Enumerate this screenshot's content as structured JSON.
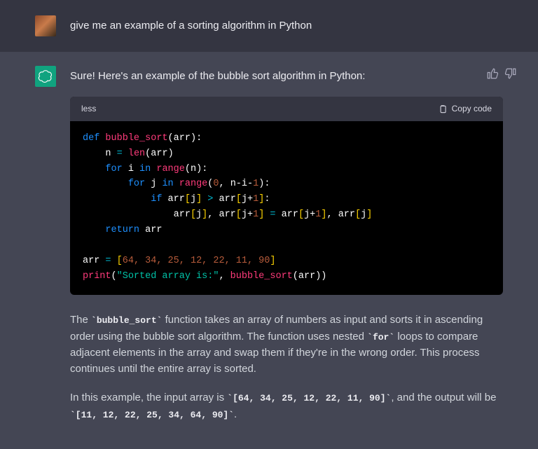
{
  "user": {
    "text": "give me an example of a sorting algorithm in Python"
  },
  "assistant": {
    "intro": "Sure! Here's an example of the bubble sort algorithm in Python:",
    "code": {
      "lang": "less",
      "copy_label": "Copy code",
      "l1_def": "def",
      "l1_fn": "bubble_sort",
      "l1_arr": "arr",
      "l2_n": "n",
      "l2_len": "len",
      "l2_arr": "arr",
      "l3_for": "for",
      "l3_i": "i",
      "l3_in": "in",
      "l3_range": "range",
      "l3_n": "n",
      "l4_for": "for",
      "l4_j": "j",
      "l4_in": "in",
      "l4_range": "range",
      "l4_z": "0",
      "l4_expr1": "n-i-",
      "l4_one": "1",
      "l5_if": "if",
      "l5_arr1": "arr",
      "l5_j1": "j",
      "l5_arr2": "arr",
      "l5_j2": "j+",
      "l5_one": "1",
      "l6_arr1": "arr",
      "l6_j1": "j",
      "l6_arr2": "arr",
      "l6_j2": "j+",
      "l6_one1": "1",
      "l6_arr3": "arr",
      "l6_j3": "j+",
      "l6_one2": "1",
      "l6_arr4": "arr",
      "l6_j4": "j",
      "l7_return": "return",
      "l7_arr": "arr",
      "l9_arr": "arr",
      "l9_list": "64, 34, 25, 12, 22, 11, 90",
      "l10_print": "print",
      "l10_str": "\"Sorted array is:\"",
      "l10_fn": "bubble_sort",
      "l10_arr": "arr"
    },
    "para1_a": "The ",
    "para1_code1": "`bubble_sort`",
    "para1_b": " function takes an array of numbers as input and sorts it in ascending order using the bubble sort algorithm. The function uses nested ",
    "para1_code2": "`for`",
    "para1_c": " loops to compare adjacent elements in the array and swap them if they're in the wrong order. This process continues until the entire array is sorted.",
    "para2_a": "In this example, the input array is ",
    "para2_code1": "`[64, 34, 25, 12, 22, 11, 90]`",
    "para2_b": ", and the output will be ",
    "para2_code2": "`[11, 12, 22, 25, 34, 64, 90]`",
    "para2_c": "."
  }
}
